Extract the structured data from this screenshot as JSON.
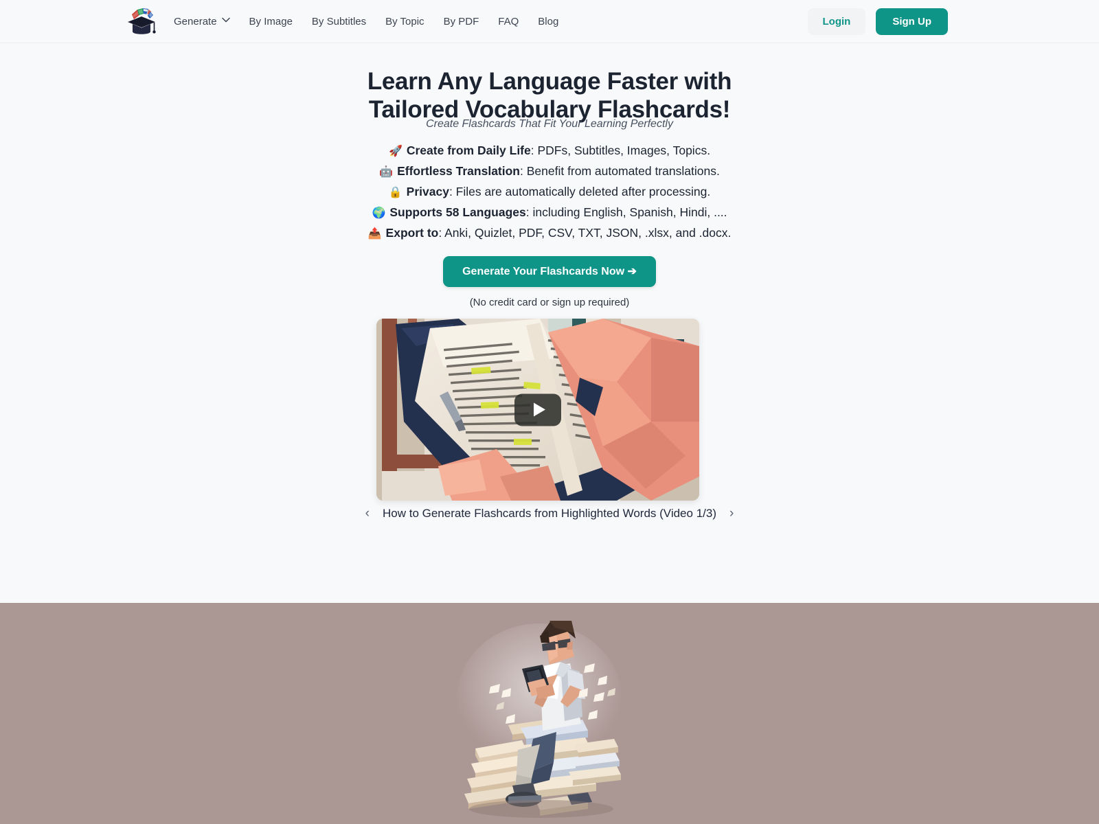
{
  "header": {
    "logo_alt": "graduation-cap-with-flags-logo",
    "nav": [
      {
        "label": "Generate",
        "has_dropdown": true
      },
      {
        "label": "By Image",
        "has_dropdown": false
      },
      {
        "label": "By Subtitles",
        "has_dropdown": false
      },
      {
        "label": "By Topic",
        "has_dropdown": false
      },
      {
        "label": "By PDF",
        "has_dropdown": false
      },
      {
        "label": "FAQ",
        "has_dropdown": false
      },
      {
        "label": "Blog",
        "has_dropdown": false
      }
    ],
    "login_label": "Login",
    "signup_label": "Sign Up"
  },
  "hero": {
    "title_line1": "Learn Any Language Faster with",
    "title_line2": "Tailored Vocabulary Flashcards!",
    "subtitle": "Create Flashcards That Fit Your Learning Perfectly",
    "features": [
      {
        "emoji": "🚀",
        "icon_name": "rocket-icon",
        "bold": "Create from Daily Life",
        "rest": ": PDFs, Subtitles, Images, Topics."
      },
      {
        "emoji": "🤖",
        "icon_name": "robot-icon",
        "bold": "Effortless Translation",
        "rest": ": Benefit from automated translations."
      },
      {
        "emoji": "🔒",
        "icon_name": "lock-icon",
        "bold": "Privacy",
        "rest": ": Files are automatically deleted after processing."
      },
      {
        "emoji": "🌍",
        "icon_name": "globe-icon",
        "bold": "Supports 58 Languages",
        "rest": ": including English, Spanish, Hindi, ...."
      },
      {
        "emoji": "📤",
        "icon_name": "outbox-tray-icon",
        "bold": "Export to",
        "rest": ": Anki, Quizlet, PDF, CSV, TXT, JSON, .xlsx, and .docx."
      }
    ],
    "cta_label": "Generate Your Flashcards Now ➔",
    "cta_note": "(No credit card or sign up required)"
  },
  "video": {
    "thumbnail_alt": "low-poly-illustration-hands-holding-book-with-highlighted-text",
    "play_icon": "play-icon",
    "prev_arrow": "‹",
    "next_arrow": "›",
    "caption": "How to Generate Flashcards from Highlighted Words (Video 1/3)"
  },
  "band": {
    "image_alt": "low-poly-illustration-person-sitting-on-stack-of-books-using-phone",
    "background_color": "#ab9794"
  },
  "colors": {
    "accent_teal": "#0f9488",
    "page_background": "#f8f9fb",
    "heading": "#1c2431",
    "login_bg": "#f2f3f5"
  }
}
